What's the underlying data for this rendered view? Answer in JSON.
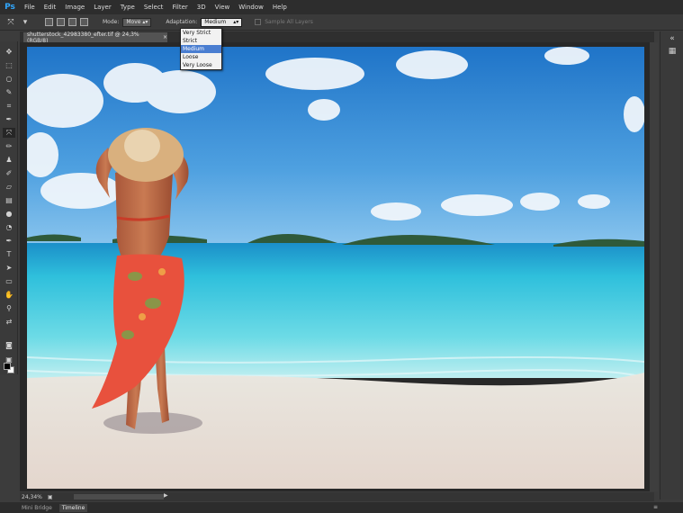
{
  "app": {
    "logo": "Ps"
  },
  "menu": [
    "File",
    "Edit",
    "Image",
    "Layer",
    "Type",
    "Select",
    "Filter",
    "3D",
    "View",
    "Window",
    "Help"
  ],
  "options_bar": {
    "mode_label": "Mode:",
    "mode_value": "Move",
    "adaptation_label": "Adaptation:",
    "adaptation_value": "Medium",
    "sample_all_layers": "Sample All Layers"
  },
  "adaptation_dropdown": {
    "options": [
      "Very Strict",
      "Strict",
      "Medium",
      "Loose",
      "Very Loose"
    ],
    "selected": "Medium",
    "highlight_color": "#4a7ed1"
  },
  "document_tab": {
    "title": "shutterstock_42983380_efter.tif @ 24,3% (RGB/8)",
    "close": "×"
  },
  "status_bar": {
    "zoom": "24,34%"
  },
  "bottom_tabs": [
    "Mini Bridge",
    "Timeline"
  ],
  "colors": {
    "menubar": "#2d2d2d",
    "panel": "#3a3a3a",
    "canvas_bg": "#282828",
    "ps_blue": "#31a8ff",
    "sky_top": "#2f86d6",
    "sea": "#3ec3d6"
  },
  "icons": {
    "toolbar": [
      "move-icon",
      "marquee-icon",
      "lasso-icon",
      "quick-select-icon",
      "crop-icon",
      "eyedropper-icon",
      "content-aware-move-icon",
      "brush-icon",
      "clone-stamp-icon",
      "history-brush-icon",
      "eraser-icon",
      "gradient-icon",
      "blur-icon",
      "dodge-icon",
      "pen-icon",
      "type-icon",
      "path-select-icon",
      "rectangle-icon",
      "hand-icon",
      "zoom-icon"
    ],
    "right_panel": [
      "panel-toggle-icon",
      "history-panel-icon"
    ]
  }
}
